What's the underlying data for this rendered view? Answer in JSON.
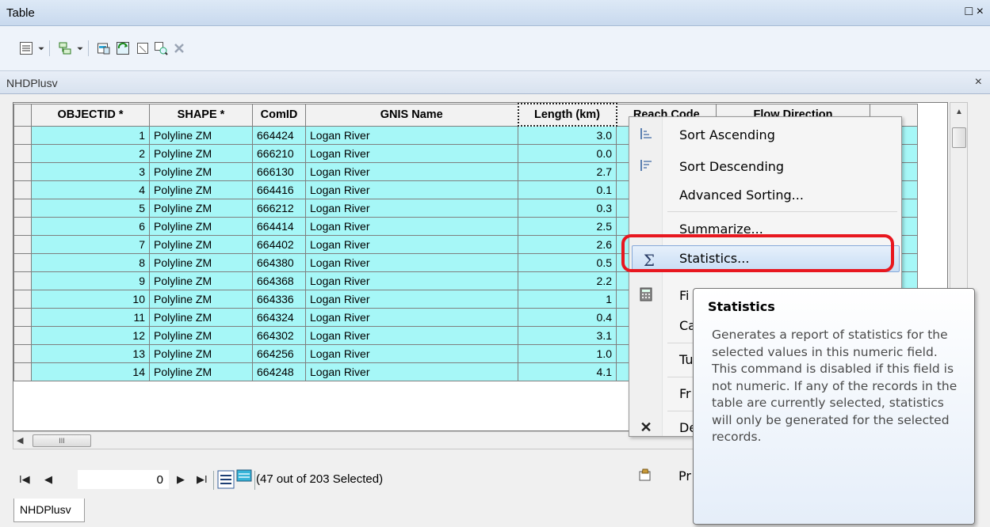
{
  "window": {
    "title": "Table",
    "controls": "□ ×"
  },
  "toolbar": {
    "icons": [
      "table-options-icon",
      "dropdown-icon",
      "related-tables-icon",
      "dropdown-icon",
      "select-by-attributes-icon",
      "switch-selection-icon",
      "clear-selection-icon",
      "zoom-to-selected-icon",
      "delete-selected-icon"
    ]
  },
  "tab": {
    "name": "NHDPlusv",
    "close": "×"
  },
  "table": {
    "columns": [
      "OBJECTID *",
      "SHAPE *",
      "ComID",
      "GNIS Name",
      "Length (km)",
      "Reach Code",
      "Flow Direction"
    ],
    "rows": [
      [
        "1",
        "Polyline ZM",
        "664424",
        "Logan River",
        "3.0"
      ],
      [
        "2",
        "Polyline ZM",
        "666210",
        "Logan River",
        "0.0"
      ],
      [
        "3",
        "Polyline ZM",
        "666130",
        "Logan River",
        "2.7"
      ],
      [
        "4",
        "Polyline ZM",
        "664416",
        "Logan River",
        "0.1"
      ],
      [
        "5",
        "Polyline ZM",
        "666212",
        "Logan River",
        "0.3"
      ],
      [
        "6",
        "Polyline ZM",
        "664414",
        "Logan River",
        "2.5"
      ],
      [
        "7",
        "Polyline ZM",
        "664402",
        "Logan River",
        "2.6"
      ],
      [
        "8",
        "Polyline ZM",
        "664380",
        "Logan River",
        "0.5"
      ],
      [
        "9",
        "Polyline ZM",
        "664368",
        "Logan River",
        "2.2"
      ],
      [
        "10",
        "Polyline ZM",
        "664336",
        "Logan River",
        "1"
      ],
      [
        "11",
        "Polyline ZM",
        "664324",
        "Logan River",
        "0.4"
      ],
      [
        "12",
        "Polyline ZM",
        "664302",
        "Logan River",
        "3.1"
      ],
      [
        "13",
        "Polyline ZM",
        "664256",
        "Logan River",
        "1.0"
      ],
      [
        "14",
        "Polyline ZM",
        "664248",
        "Logan River",
        "4.1"
      ]
    ]
  },
  "hscroll": {
    "thumb": "III"
  },
  "nav": {
    "first": "I◀",
    "prev": "◀",
    "record": "0",
    "next": "▶",
    "last": "▶I",
    "selection": "(47 out of 203 Selected)"
  },
  "bottom_tab": "NHDPlusv",
  "menu": {
    "items": [
      {
        "label": "Sort Ascending",
        "icon": "sort-ascending-icon"
      },
      {
        "label": "Sort Descending",
        "icon": "sort-descending-icon"
      },
      {
        "label": "Advanced Sorting...",
        "icon": ""
      },
      {
        "label": "Summarize...",
        "icon": ""
      },
      {
        "label": "Statistics...",
        "icon": "sigma-icon"
      },
      {
        "label": "Fi",
        "icon": "calculator-icon"
      },
      {
        "label": "Ca",
        "icon": ""
      },
      {
        "label": "Tu",
        "icon": ""
      },
      {
        "label": "Fr",
        "icon": ""
      },
      {
        "label": "De",
        "icon": "delete-icon"
      },
      {
        "label": "Pr",
        "icon": "properties-icon"
      }
    ]
  },
  "tooltip": {
    "title": "Statistics",
    "body": "Generates a report of statistics for the selected values in this numeric field. This command is disabled if this field is not numeric. If any of the records in the table are currently selected, statistics will only be generated for the selected records."
  },
  "colors": {
    "selected_row": "#a6f7f7",
    "highlight": "#e8171f"
  }
}
